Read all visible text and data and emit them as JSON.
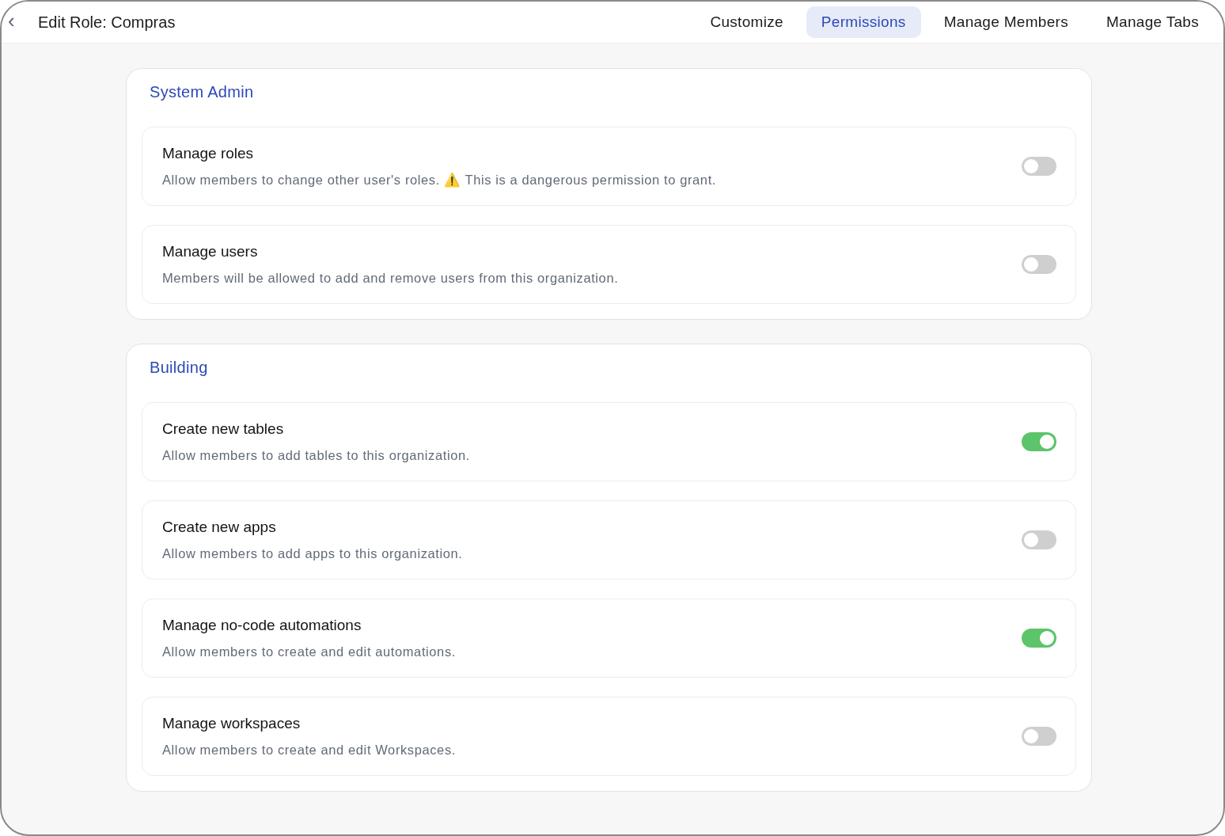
{
  "header": {
    "back": "‹",
    "title": "Edit Role: Compras"
  },
  "tabs": [
    {
      "label": "Customize",
      "selected": false
    },
    {
      "label": "Permissions",
      "selected": true
    },
    {
      "label": "Manage Members",
      "selected": false
    },
    {
      "label": "Manage Tabs",
      "selected": false
    }
  ],
  "sections": [
    {
      "title": "System Admin",
      "permissions": [
        {
          "name": "Manage roles",
          "description": "Allow members to change other user's roles. ⚠️ This is a dangerous permission to grant.",
          "on": false
        },
        {
          "name": "Manage users",
          "description": "Members will be allowed to add and remove users from this organization.",
          "on": false
        }
      ]
    },
    {
      "title": "Building",
      "permissions": [
        {
          "name": "Create new tables",
          "description": "Allow members to add tables to this organization.",
          "on": true
        },
        {
          "name": "Create new apps",
          "description": "Allow members to add apps to this organization.",
          "on": false
        },
        {
          "name": "Manage no-code automations",
          "description": "Allow members to create and edit automations.",
          "on": true
        },
        {
          "name": "Manage workspaces",
          "description": "Allow members to create and edit Workspaces.",
          "on": false
        }
      ]
    }
  ]
}
